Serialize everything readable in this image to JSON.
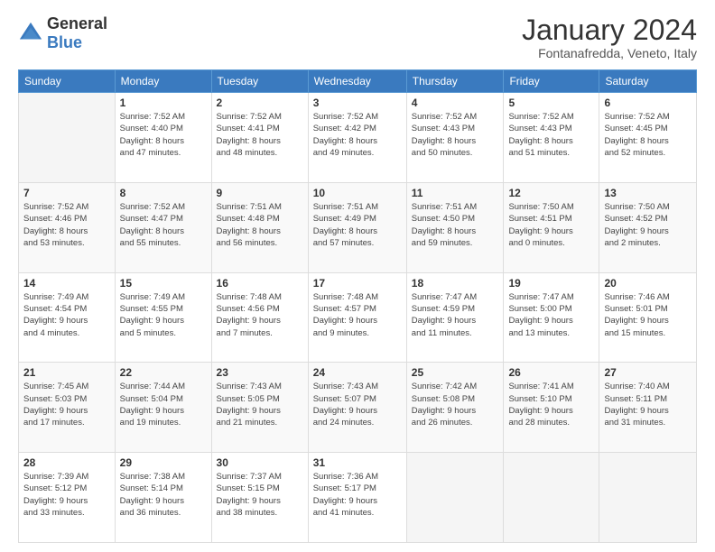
{
  "header": {
    "logo": {
      "general": "General",
      "blue": "Blue"
    },
    "title": "January 2024",
    "location": "Fontanafredda, Veneto, Italy"
  },
  "weekdays": [
    "Sunday",
    "Monday",
    "Tuesday",
    "Wednesday",
    "Thursday",
    "Friday",
    "Saturday"
  ],
  "weeks": [
    [
      {
        "day": "",
        "info": ""
      },
      {
        "day": "1",
        "info": "Sunrise: 7:52 AM\nSunset: 4:40 PM\nDaylight: 8 hours\nand 47 minutes."
      },
      {
        "day": "2",
        "info": "Sunrise: 7:52 AM\nSunset: 4:41 PM\nDaylight: 8 hours\nand 48 minutes."
      },
      {
        "day": "3",
        "info": "Sunrise: 7:52 AM\nSunset: 4:42 PM\nDaylight: 8 hours\nand 49 minutes."
      },
      {
        "day": "4",
        "info": "Sunrise: 7:52 AM\nSunset: 4:43 PM\nDaylight: 8 hours\nand 50 minutes."
      },
      {
        "day": "5",
        "info": "Sunrise: 7:52 AM\nSunset: 4:43 PM\nDaylight: 8 hours\nand 51 minutes."
      },
      {
        "day": "6",
        "info": "Sunrise: 7:52 AM\nSunset: 4:45 PM\nDaylight: 8 hours\nand 52 minutes."
      }
    ],
    [
      {
        "day": "7",
        "info": "Sunrise: 7:52 AM\nSunset: 4:46 PM\nDaylight: 8 hours\nand 53 minutes."
      },
      {
        "day": "8",
        "info": "Sunrise: 7:52 AM\nSunset: 4:47 PM\nDaylight: 8 hours\nand 55 minutes."
      },
      {
        "day": "9",
        "info": "Sunrise: 7:51 AM\nSunset: 4:48 PM\nDaylight: 8 hours\nand 56 minutes."
      },
      {
        "day": "10",
        "info": "Sunrise: 7:51 AM\nSunset: 4:49 PM\nDaylight: 8 hours\nand 57 minutes."
      },
      {
        "day": "11",
        "info": "Sunrise: 7:51 AM\nSunset: 4:50 PM\nDaylight: 8 hours\nand 59 minutes."
      },
      {
        "day": "12",
        "info": "Sunrise: 7:50 AM\nSunset: 4:51 PM\nDaylight: 9 hours\nand 0 minutes."
      },
      {
        "day": "13",
        "info": "Sunrise: 7:50 AM\nSunset: 4:52 PM\nDaylight: 9 hours\nand 2 minutes."
      }
    ],
    [
      {
        "day": "14",
        "info": "Sunrise: 7:49 AM\nSunset: 4:54 PM\nDaylight: 9 hours\nand 4 minutes."
      },
      {
        "day": "15",
        "info": "Sunrise: 7:49 AM\nSunset: 4:55 PM\nDaylight: 9 hours\nand 5 minutes."
      },
      {
        "day": "16",
        "info": "Sunrise: 7:48 AM\nSunset: 4:56 PM\nDaylight: 9 hours\nand 7 minutes."
      },
      {
        "day": "17",
        "info": "Sunrise: 7:48 AM\nSunset: 4:57 PM\nDaylight: 9 hours\nand 9 minutes."
      },
      {
        "day": "18",
        "info": "Sunrise: 7:47 AM\nSunset: 4:59 PM\nDaylight: 9 hours\nand 11 minutes."
      },
      {
        "day": "19",
        "info": "Sunrise: 7:47 AM\nSunset: 5:00 PM\nDaylight: 9 hours\nand 13 minutes."
      },
      {
        "day": "20",
        "info": "Sunrise: 7:46 AM\nSunset: 5:01 PM\nDaylight: 9 hours\nand 15 minutes."
      }
    ],
    [
      {
        "day": "21",
        "info": "Sunrise: 7:45 AM\nSunset: 5:03 PM\nDaylight: 9 hours\nand 17 minutes."
      },
      {
        "day": "22",
        "info": "Sunrise: 7:44 AM\nSunset: 5:04 PM\nDaylight: 9 hours\nand 19 minutes."
      },
      {
        "day": "23",
        "info": "Sunrise: 7:43 AM\nSunset: 5:05 PM\nDaylight: 9 hours\nand 21 minutes."
      },
      {
        "day": "24",
        "info": "Sunrise: 7:43 AM\nSunset: 5:07 PM\nDaylight: 9 hours\nand 24 minutes."
      },
      {
        "day": "25",
        "info": "Sunrise: 7:42 AM\nSunset: 5:08 PM\nDaylight: 9 hours\nand 26 minutes."
      },
      {
        "day": "26",
        "info": "Sunrise: 7:41 AM\nSunset: 5:10 PM\nDaylight: 9 hours\nand 28 minutes."
      },
      {
        "day": "27",
        "info": "Sunrise: 7:40 AM\nSunset: 5:11 PM\nDaylight: 9 hours\nand 31 minutes."
      }
    ],
    [
      {
        "day": "28",
        "info": "Sunrise: 7:39 AM\nSunset: 5:12 PM\nDaylight: 9 hours\nand 33 minutes."
      },
      {
        "day": "29",
        "info": "Sunrise: 7:38 AM\nSunset: 5:14 PM\nDaylight: 9 hours\nand 36 minutes."
      },
      {
        "day": "30",
        "info": "Sunrise: 7:37 AM\nSunset: 5:15 PM\nDaylight: 9 hours\nand 38 minutes."
      },
      {
        "day": "31",
        "info": "Sunrise: 7:36 AM\nSunset: 5:17 PM\nDaylight: 9 hours\nand 41 minutes."
      },
      {
        "day": "",
        "info": ""
      },
      {
        "day": "",
        "info": ""
      },
      {
        "day": "",
        "info": ""
      }
    ]
  ]
}
